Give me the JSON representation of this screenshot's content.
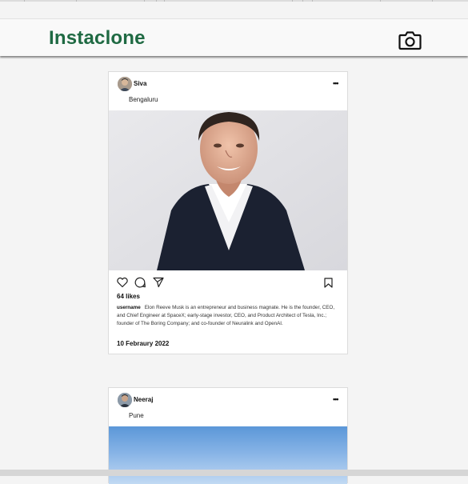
{
  "header": {
    "brand": "Instaclone",
    "camera_icon": "camera-icon"
  },
  "posts": [
    {
      "username": "Siva",
      "location": "Bengaluru",
      "likes": "64 likes",
      "caption_user": "username",
      "caption": "Elon Reeve Musk is an entrepreneur and business magnate. He is the founder, CEO, and Chief Engineer at SpaceX; early-stage investor, CEO, and Product Architect of Tesla, Inc.; founder of The Boring Company; and co-founder of Neuralink and OpenAI.",
      "date": "10 Febraury 2022"
    },
    {
      "username": "Neeraj",
      "location": "Pune"
    }
  ],
  "colors": {
    "brand": "#1f6a43",
    "background": "#f4f4f4",
    "card": "#ffffff"
  }
}
